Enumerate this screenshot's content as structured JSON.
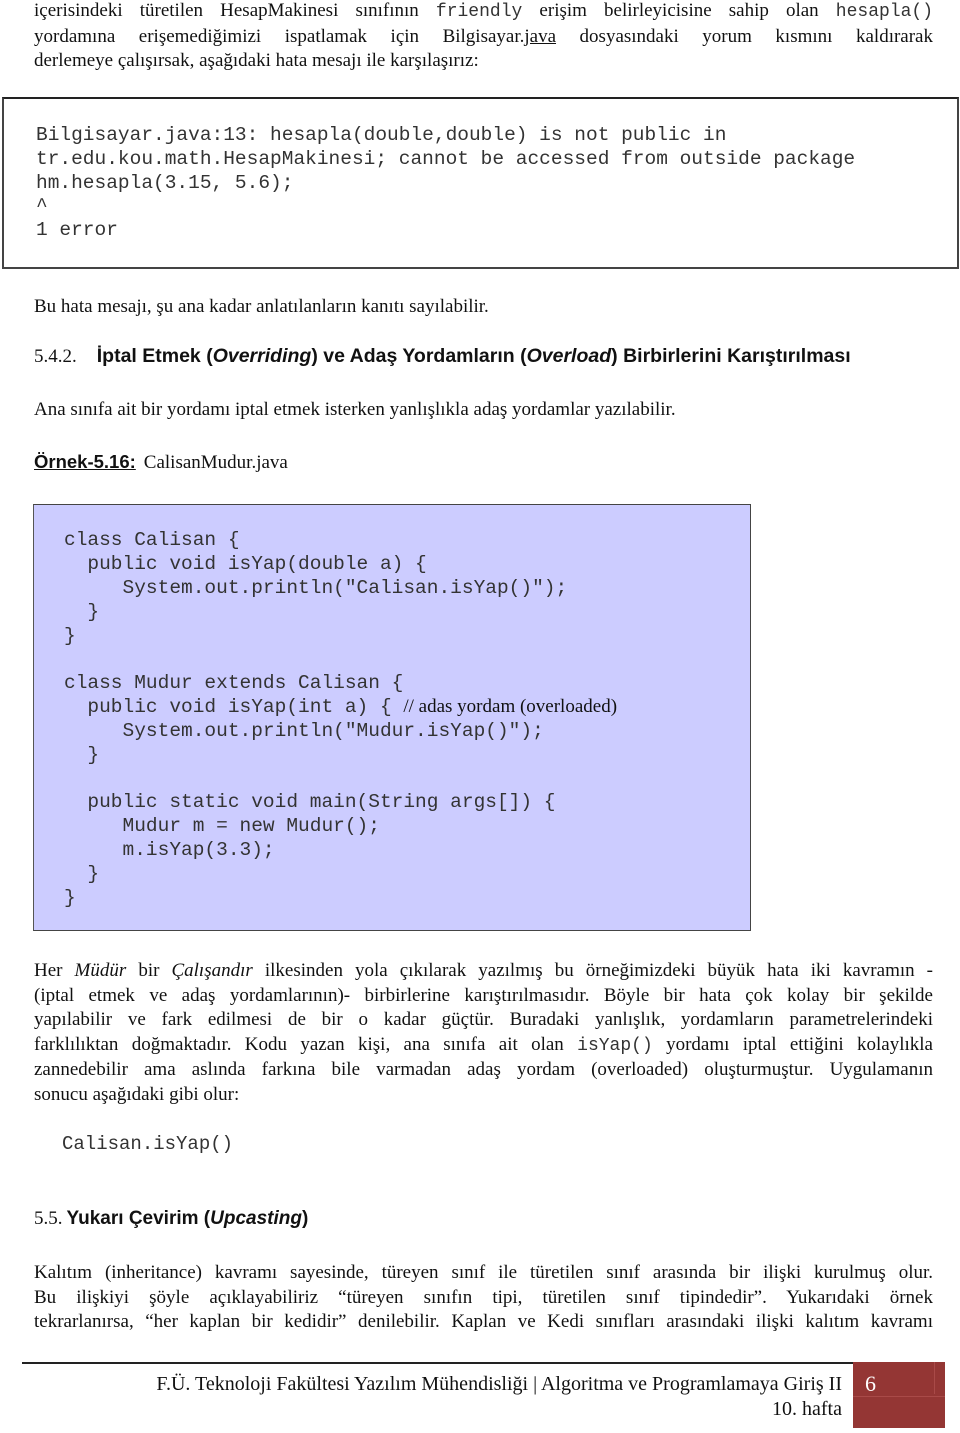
{
  "intro": {
    "line1_a": "içerisindeki türetilen HesapMakinesi sınıfının ",
    "line1_code1": "friendly",
    "line1_b": " erişim belirleyicisine sahip olan ",
    "line1_code2": "hesapla()",
    "line2_a": "yordamına erişemediğimizi ispatlamak için Bilgisayar.",
    "line2_link": "java",
    "line2_b": " dosyasındaki yorum kısmını kaldırarak",
    "line3": "derlemeye çalışırsak, aşağıdaki hata mesajı ile karşılaşırız:"
  },
  "error_box": {
    "lines": [
      "Bilgisayar.java:13: hesapla(double,double) is not public in",
      "tr.edu.kou.math.HesapMakinesi; cannot be accessed from outside package",
      "hm.hesapla(3.15, 5.6);",
      "^",
      "1 error"
    ]
  },
  "evidence_text": "Bu hata mesajı, şu ana kadar anlatılanların kanıtı sayılabilir.",
  "section_542": {
    "number": "5.4.2.",
    "t1": "İptal Etmek (",
    "t2": "Overriding",
    "t3": ") ve Adaş Yordamların (",
    "t4": "Overload",
    "t5": ") Birbirlerini Karıştırılması"
  },
  "ana_text": "Ana sınıfa ait bir yordamı iptal etmek isterken yanlışlıkla adaş yordamlar yazılabilir.",
  "example": {
    "label": "Örnek-5.16:",
    "filename": "CalisanMudur.java"
  },
  "code": {
    "lines": [
      "class Calisan {",
      "  public void isYap(double a) {",
      "     System.out.println(\"Calisan.isYap()\");",
      "  }",
      "}",
      "class Mudur extends Calisan {",
      "  public void isYap(int a) { ",
      "     System.out.println(\"Mudur.isYap()\");",
      "  }",
      "  public static void main(String args[]) {",
      "     Mudur m = new Mudur();",
      "     m.isYap(3.3);",
      "  }",
      "}"
    ],
    "comment": "// adas yordam (overloaded)"
  },
  "explain": {
    "l1_a": "Her ",
    "l1_i1": "Müdür",
    "l1_b": " bir ",
    "l1_i2": "Çalışandır",
    "l1_c": " ilkesinden yola çıkılarak yazılmış bu örneğimizdeki büyük hata iki kavramın -",
    "l2": "(iptal etmek ve adaş yordamlarının)- birbirlerine karıştırılmasıdır. Böyle bir hata çok kolay bir şekilde",
    "l3": "yapılabilir ve fark edilmesi de bir o kadar güçtür. Buradaki yanlışlık, yordamların parametrelerindeki",
    "l4_a": "farklılıktan doğmaktadır. Kodu yazan kişi, ana sınıfa ait olan ",
    "l4_code": "isYap()",
    "l4_b": " yordamı iptal ettiğini kolaylıkla",
    "l5": "zannedebilir ama aslında farkına bile varmadan adaş yordam (overloaded) oluşturmuştur. Uygulamanın",
    "l6": "sonucu aşağıdaki gibi olur:"
  },
  "output_text": "Calisan.isYap()",
  "section_55": {
    "number": "5.5.",
    "t1": "Yukarı Çevirim (",
    "t2": "Upcasting",
    "t3": ")"
  },
  "kalitim": {
    "l1": "Kalıtım (inheritance) kavramı sayesinde, türeyen sınıf ile türetilen sınıf arasında bir ilişki kurulmuş olur.",
    "l2": "Bu ilişkiyi şöyle açıklayabiliriz “türeyen sınıfın tipi, türetilen sınıf tipindedir”. Yukarıdaki örnek",
    "l3": "tekrarlanırsa, “her kaplan bir kedidir” denilebilir. Kaplan ve Kedi sınıfları arasındaki ilişki kalıtım kavramı"
  },
  "footer": {
    "line1": "F.Ü. Teknoloji Fakültesi Yazılım Mühendisliği | Algoritma ve Programlamaya Giriş II",
    "line2": "10. hafta",
    "page_number": "6",
    "accent_color": "#943634"
  }
}
